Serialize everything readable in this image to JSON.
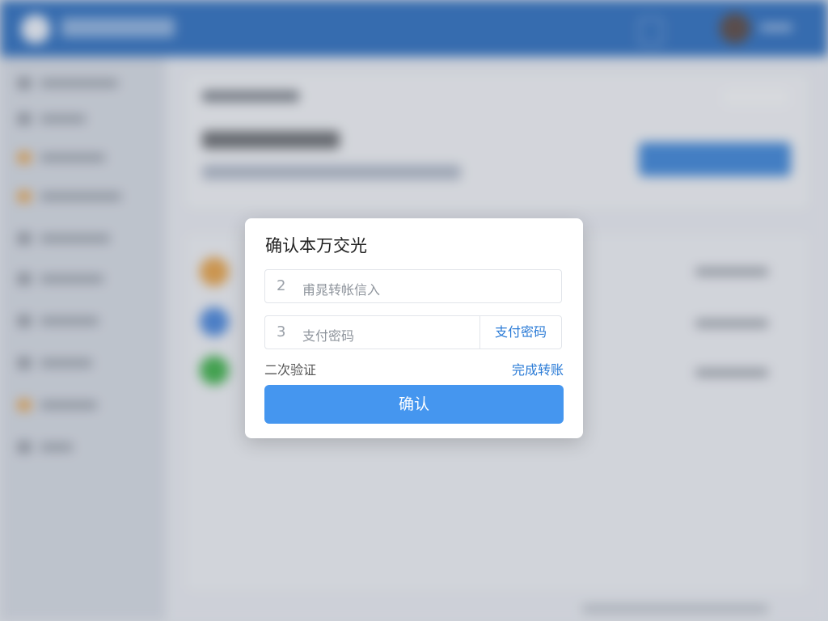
{
  "modal": {
    "title": "确认本万交光",
    "field1": {
      "number": "2",
      "placeholder": "甫晁转帐信入"
    },
    "field2": {
      "number": "3",
      "placeholder": "支付密码",
      "addon": "支付密码"
    },
    "footer_left": "二次验证",
    "footer_right": "完成转账",
    "confirm_label": "确认"
  },
  "colors": {
    "primary": "#4596ef",
    "link": "#2b7bd6",
    "header": "#2f6fbd",
    "status_orange": "#e4a24a",
    "status_blue": "#4a86d9",
    "status_green": "#3fb04a"
  },
  "icons": [
    "logo-icon",
    "document-icon",
    "user-avatar",
    "check-icon"
  ]
}
